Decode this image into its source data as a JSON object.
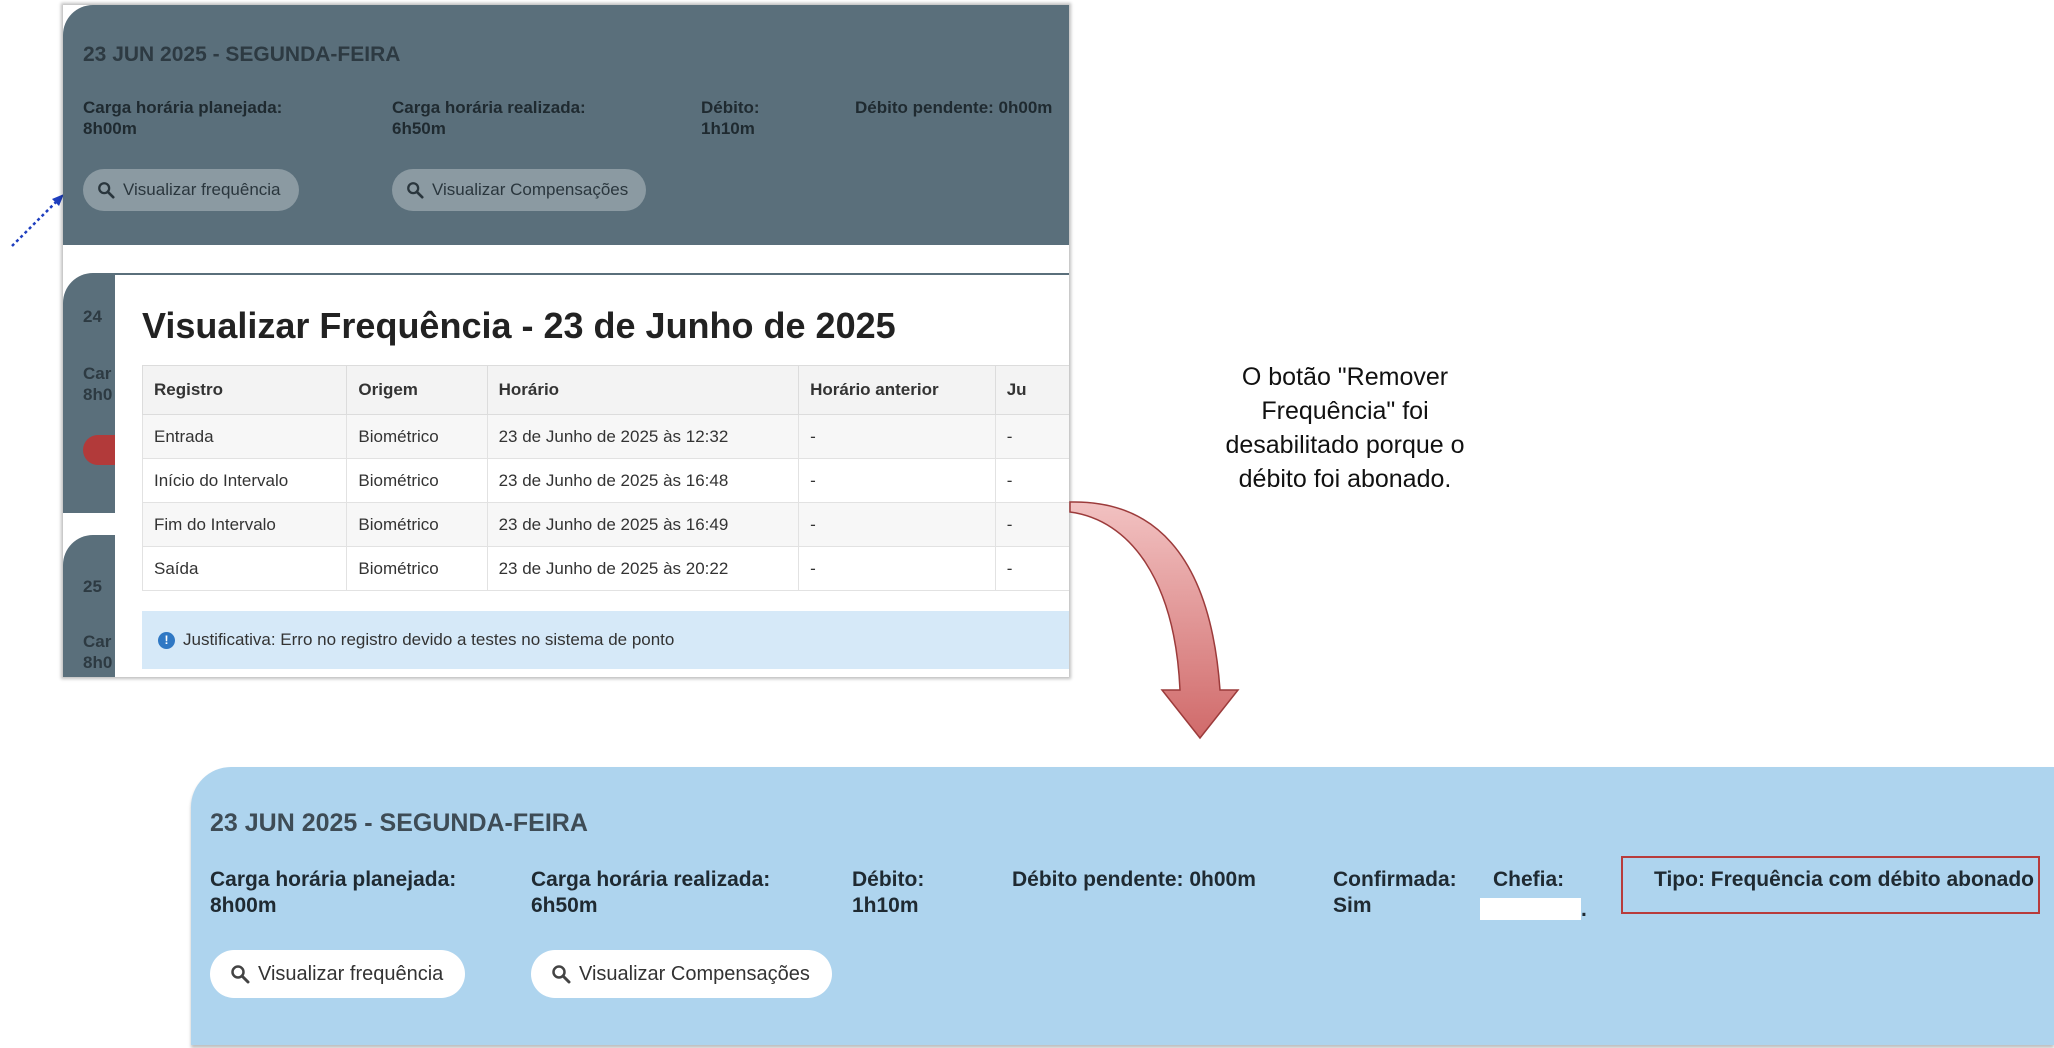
{
  "top_screenshot": {
    "day_card": {
      "title": "23 JUN 2025 - SEGUNDA-FEIRA",
      "planned_label": "Carga horária planejada:",
      "planned_value": "8h00m",
      "realized_label": "Carga horária realizada:",
      "realized_value": "6h50m",
      "debit_label": "Débito:",
      "debit_value": "1h10m",
      "pending_debit": "Débito pendente: 0h00m",
      "view_frequency_button": "Visualizar frequência",
      "view_compensations_button": "Visualizar Compensações"
    },
    "hidden_cards": {
      "card2_day": "24",
      "card2_line1": "Car",
      "card2_line2": "8h0",
      "card3_day": "25",
      "card3_line1": "Car",
      "card3_line2": "8h0"
    },
    "modal": {
      "title": "Visualizar Frequência - 23 de Junho de 2025",
      "columns": [
        "Registro",
        "Origem",
        "Horário",
        "Horário anterior",
        "Ju"
      ],
      "rows": [
        [
          "Entrada",
          "Biométrico",
          "23 de Junho de 2025 às 12:32",
          "-",
          "-"
        ],
        [
          "Início do Intervalo",
          "Biométrico",
          "23 de Junho de 2025 às 16:48",
          "-",
          "-"
        ],
        [
          "Fim do Intervalo",
          "Biométrico",
          "23 de Junho de 2025 às 16:49",
          "-",
          "-"
        ],
        [
          "Saída",
          "Biométrico",
          "23 de Junho de 2025 às 20:22",
          "-",
          "-"
        ]
      ],
      "justification": "Justificativa: Erro no registro devido a testes no sistema de ponto",
      "info_glyph": "!"
    }
  },
  "annotation": {
    "text": "O botão \"Remover Frequência\" foi desabilitado porque o débito foi abonado."
  },
  "bottom_screenshot": {
    "title": "23 JUN 2025 - SEGUNDA-FEIRA",
    "planned_label": "Carga horária planejada:",
    "planned_value": "8h00m",
    "realized_label": "Carga horária realizada:",
    "realized_value": "6h50m",
    "debit_label": "Débito:",
    "debit_value": "1h10m",
    "pending_debit": "Débito pendente: 0h00m",
    "confirmed_label": "Confirmada:",
    "confirmed_value": "Sim",
    "chefia_label": "Chefia:",
    "chefia_suffix": ".",
    "tipo": "Tipo: Frequência com débito abonado",
    "view_frequency_button": "Visualizar frequência",
    "view_compensations_button": "Visualizar Compensações"
  },
  "colors": {
    "dark_card": "#5a6f7b",
    "light_card": "#aed4ee",
    "highlight_border": "#b83b3b",
    "arrow_fill": "#d97a7a",
    "pointer_arrow": "#1f3fbf"
  },
  "icons": [
    "search-icon",
    "info-icon",
    "trash-icon",
    "curved-arrow",
    "dotted-pointer-arrow"
  ]
}
